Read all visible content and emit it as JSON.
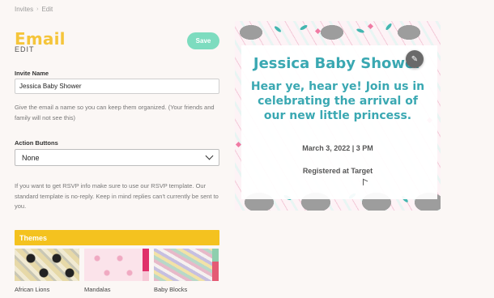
{
  "breadcrumb": {
    "parent": "Invites",
    "separator": "›",
    "current": "Edit"
  },
  "header": {
    "title": "Email",
    "subtitle": "EDIT",
    "save_label": "Save"
  },
  "invite_name": {
    "label": "Invite Name",
    "value": "Jessica Baby Shower",
    "help": "Give the email a name so you can keep them organized. (Your friends and family will not see this)"
  },
  "action_buttons": {
    "label": "Action Buttons",
    "selected": "None",
    "help": "If you want to get RSVP info make sure to use our RSVP template. Our standard template is no-reply. Keep in mind replies can't currently be sent to you."
  },
  "themes": {
    "heading": "Themes",
    "items": [
      {
        "label": "African Lions"
      },
      {
        "label": "Mandalas"
      },
      {
        "label": "Baby Blocks"
      }
    ]
  },
  "preview": {
    "title": "Jessica Baby Shower",
    "message": "Hear ye, hear ye! Join us in celebrating the arrival of our new little princess.",
    "date": "March 3, 2022 | 3 PM",
    "location": "Registered at Target",
    "edit_icon": "pencil-icon"
  },
  "colors": {
    "accent_yellow": "#f5c53a",
    "save_green": "#7ddcbf",
    "preview_teal": "#3aa8b2"
  }
}
